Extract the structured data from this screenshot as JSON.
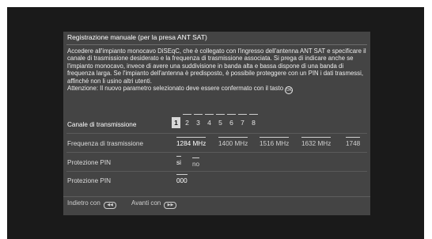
{
  "dialog": {
    "title": "Registrazione manuale (per la presa ANT SAT)",
    "intro": "Accedere all'impianto monocavo DiSEqC, che è collegato con l'ingresso dell'antenna ANT SAT e specificare il canale di trasmissione desiderato e la frequenza di trasmissione associata. Si prega di indicare anche se l'impianto monocavo, invece di avere una suddivisione in banda alta e bassa dispone di una banda di frequenza larga. Se l'impianto dell'antenna è predisposto, è possibile proteggere con un PIN i dati trasmessi, affinché non li usino altri utenti.",
    "confirm_text": "Attenzione: Il nuovo parametro selezionato deve essere confermato con il tasto",
    "confirm_icon": "ok-icon"
  },
  "channel": {
    "label": "Canale di transmissione",
    "options": [
      "1",
      "2",
      "3",
      "4",
      "5",
      "6",
      "7",
      "8"
    ],
    "selected": "1"
  },
  "frequency": {
    "label": "Frequenza di trasmissione",
    "options": [
      "1284 MHz",
      "1400 MHz",
      "1516 MHz",
      "1632 MHz",
      "1748"
    ],
    "selected": "1284 MHz"
  },
  "pin_protection": {
    "label": "Protezione PIN",
    "options": [
      "si",
      "no"
    ],
    "selected": "si"
  },
  "pin": {
    "label": "Protezione PIN",
    "value": "000"
  },
  "footer": {
    "back_label": "Indietro con",
    "back_icon": "rewind-button-icon",
    "forward_label": "Avanti con",
    "forward_icon": "forward-button-icon"
  },
  "colors": {
    "screen_bg": "#1a1a1a",
    "panel_bg": "#444444",
    "selected_bg": "#d8d8d8"
  }
}
